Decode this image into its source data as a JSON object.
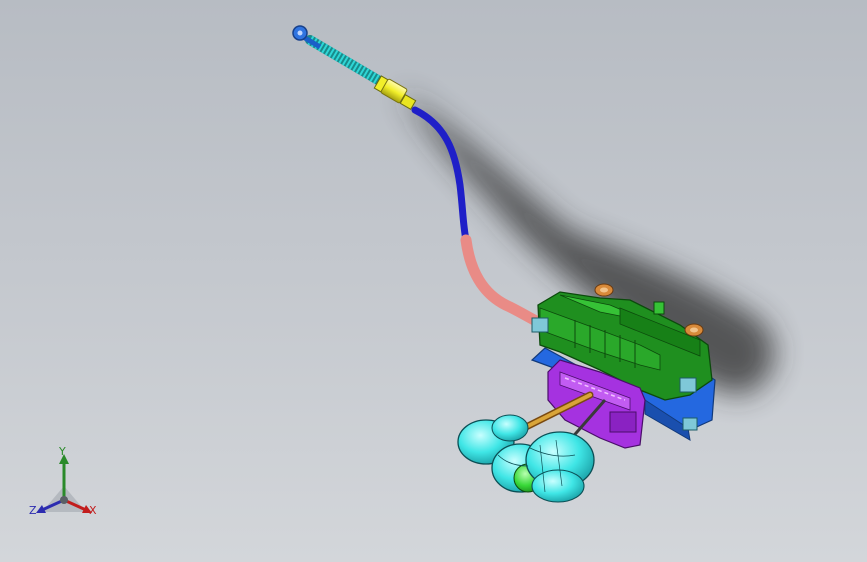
{
  "viewport": {
    "background_top": "#b7bcc3",
    "background_bottom": "#d3d6da"
  },
  "model": {
    "colors": {
      "cable_sheath": "#1f1fc8",
      "cable_pink": "#e98b86",
      "spring": "#2fd6d6",
      "ferrule": "#f2ef2a",
      "bracket_green": "#1f8f1f",
      "base_blue": "#2468e0",
      "gate_purple": "#a532e0",
      "lever_gold": "#d9a538",
      "knob_cyan": "#3fe6e6",
      "knob_green": "#38d838",
      "bolt_orange": "#d88a3a"
    }
  },
  "triad": {
    "x_label": "X",
    "y_label": "Y",
    "z_label": "Z",
    "x_color": "#c21d1d",
    "y_color": "#2a8a2a",
    "z_color": "#2c2cb0"
  }
}
